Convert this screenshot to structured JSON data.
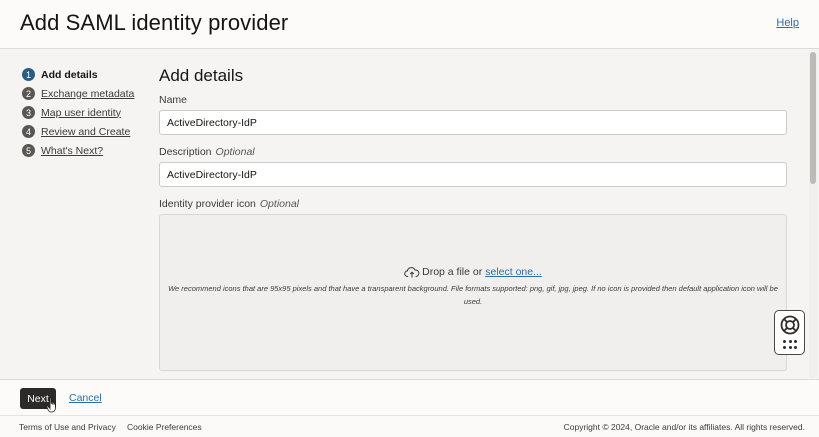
{
  "header": {
    "title": "Add SAML identity provider",
    "help_label": "Help"
  },
  "steps": [
    {
      "number": "1",
      "label": "Add details",
      "active": true
    },
    {
      "number": "2",
      "label": "Exchange metadata",
      "active": false
    },
    {
      "number": "3",
      "label": "Map user identity",
      "active": false
    },
    {
      "number": "4",
      "label": "Review and Create",
      "active": false
    },
    {
      "number": "5",
      "label": "What's Next?",
      "active": false
    }
  ],
  "form": {
    "section_title": "Add details",
    "name": {
      "label": "Name",
      "value": "ActiveDirectory-IdP"
    },
    "description": {
      "label": "Description",
      "optional": "Optional",
      "value": "ActiveDirectory-IdP"
    },
    "icon": {
      "label": "Identity provider icon",
      "optional": "Optional",
      "drop_text": "Drop a file or",
      "select_link": "select one...",
      "hint": "We recommend icons that are 95x95 pixels and that have a transparent background. File formats supported: png, gif, jpg, jpeg. If no icon is provided then default application icon will be used."
    }
  },
  "actions": {
    "next_label": "Next",
    "cancel_label": "Cancel"
  },
  "footer": {
    "terms": "Terms of Use and Privacy",
    "cookies": "Cookie Preferences",
    "copyright": "Copyright © 2024, Oracle and/or its affiliates. All rights reserved."
  },
  "icons": {
    "upload": "cloud-upload-icon",
    "help_widget": "lifebuoy-icon",
    "apps": "grid-dots-icon"
  },
  "colors": {
    "active_step": "#2a5d86",
    "link": "#2e6ea8",
    "primary_button": "#2b2a29"
  }
}
